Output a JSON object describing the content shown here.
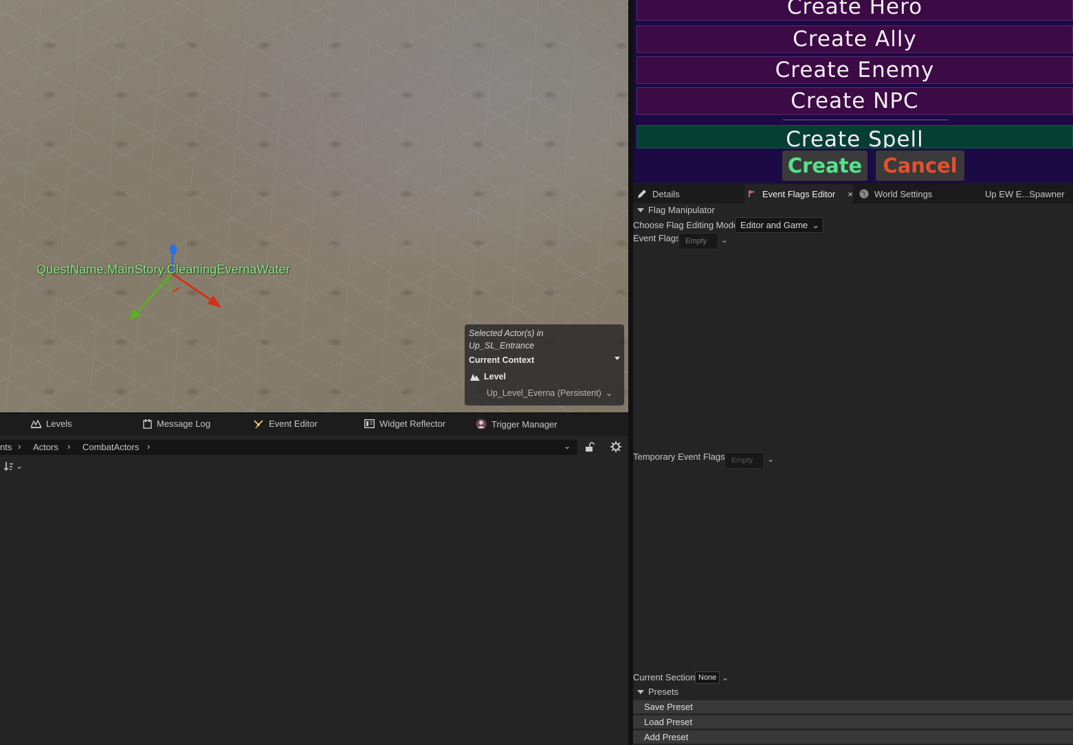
{
  "viewport": {
    "quest_label": "QuestName.MainStory.CleaningEvernaWater",
    "context_popup": {
      "title_line1": "Selected Actor(s) in",
      "title_line2": "Up_SL_Entrance",
      "current_context": "Current Context",
      "level_label": "Level",
      "level_value": "Up_Level_Everna (Persistent)"
    }
  },
  "bottom_tabs": [
    {
      "label": "Levels",
      "icon": "levels-icon"
    },
    {
      "label": "Message Log",
      "icon": "message-log-icon"
    },
    {
      "label": "Event Editor",
      "icon": "event-editor-icon"
    },
    {
      "label": "Widget Reflector",
      "icon": "widget-reflector-icon"
    },
    {
      "label": "Trigger Manager",
      "icon": "trigger-manager-icon"
    }
  ],
  "breadcrumb": {
    "items": [
      "nts",
      "Actors",
      "CombatActors"
    ]
  },
  "create_panel": {
    "buttons": [
      "Create Hero",
      "Create Ally",
      "Create Enemy",
      "Create NPC"
    ],
    "spell_button": "Create Spell",
    "create_label": "Create",
    "cancel_label": "Cancel",
    "colors": {
      "create": "#55e38a",
      "cancel": "#e5502e",
      "character_bg": "#3c0a45",
      "spell_bg": "#053f33",
      "panel_bg": "#1b0a44"
    }
  },
  "right_tabs": [
    {
      "label": "Details",
      "icon": "pencil-icon"
    },
    {
      "label": "Event Flags Editor",
      "icon": "flag-icon",
      "active": true
    },
    {
      "label": "World Settings",
      "icon": "globe-icon"
    },
    {
      "label": "Up EW E...Spawner",
      "icon": ""
    }
  ],
  "flag_manipulator": {
    "section": "Flag Manipulator",
    "mode_label": "Choose Flag Editing Mode",
    "mode_value": "Editor and Game",
    "event_flags_label": "Event Flags",
    "event_flags_value": "Empty",
    "temp_flags_label": "Temporary Event Flags",
    "temp_flags_value": "Empty",
    "current_section_label": "Current Section",
    "current_section_value": "None"
  },
  "presets": {
    "section": "Presets",
    "items": [
      "Save Preset",
      "Load Preset",
      "Add Preset"
    ]
  }
}
